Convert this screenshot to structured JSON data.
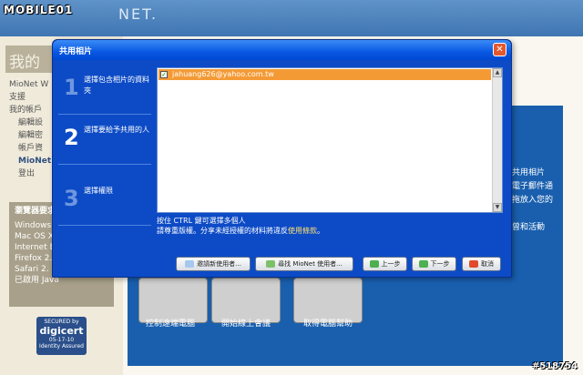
{
  "watermark": "MOBILE01",
  "brand": "NET.",
  "photo_credit": "#518754",
  "left": {
    "title": "我的帳",
    "nav": [
      {
        "label": "MioNet W",
        "level": 0,
        "bold": false
      },
      {
        "label": "支援",
        "level": 0,
        "bold": false
      },
      {
        "label": "我的帳戶",
        "level": 0,
        "bold": false
      },
      {
        "label": "編輯設",
        "level": 1,
        "bold": false
      },
      {
        "label": "編輯密",
        "level": 1,
        "bold": false
      },
      {
        "label": "帳戶資",
        "level": 1,
        "bold": false
      },
      {
        "label": "MioNet",
        "level": 1,
        "bold": true
      },
      {
        "label": "登出",
        "level": 1,
        "bold": false
      }
    ],
    "browser_header": "瀏覽器要求",
    "browsers": [
      "Windows Vista",
      "Mac OS X",
      "Internet E",
      "Firefox 2.",
      "Safari 2.",
      "已啟用 Java"
    ],
    "digicert": {
      "secured": "SECURED by",
      "name": "digicert",
      "date": "05-17-10",
      "assured": "Identity Assured"
    }
  },
  "right_menu": [
    "共用相片",
    "電子郵件通",
    "拖放入您的",
    "",
    "曾和活動"
  ],
  "features": [
    "控制遠端電腦",
    "開始線上會議",
    "取得電腦幫助"
  ],
  "dialog": {
    "title": "共用相片",
    "close": "✕",
    "steps": [
      {
        "num": "1",
        "text": "選擇包含相片的資料夾",
        "active": false
      },
      {
        "num": "2",
        "text": "選擇要給予共用的人",
        "active": true
      },
      {
        "num": "3",
        "text": "選擇權限",
        "active": false
      }
    ],
    "list_items": [
      "jahuang626@yahoo.com.tw"
    ],
    "hint1": "按住 CTRL 鍵可選擇多個人",
    "hint2_prefix": "請尊重版權。分享未經授權的材料將違反",
    "hint2_link": "使用條款",
    "hint2_suffix": "。",
    "buttons": {
      "invite": "邀請新使用者...",
      "find": "尋找 MioNet 使用者...",
      "prev": "上一步",
      "next": "下一步",
      "cancel": "取消"
    }
  }
}
